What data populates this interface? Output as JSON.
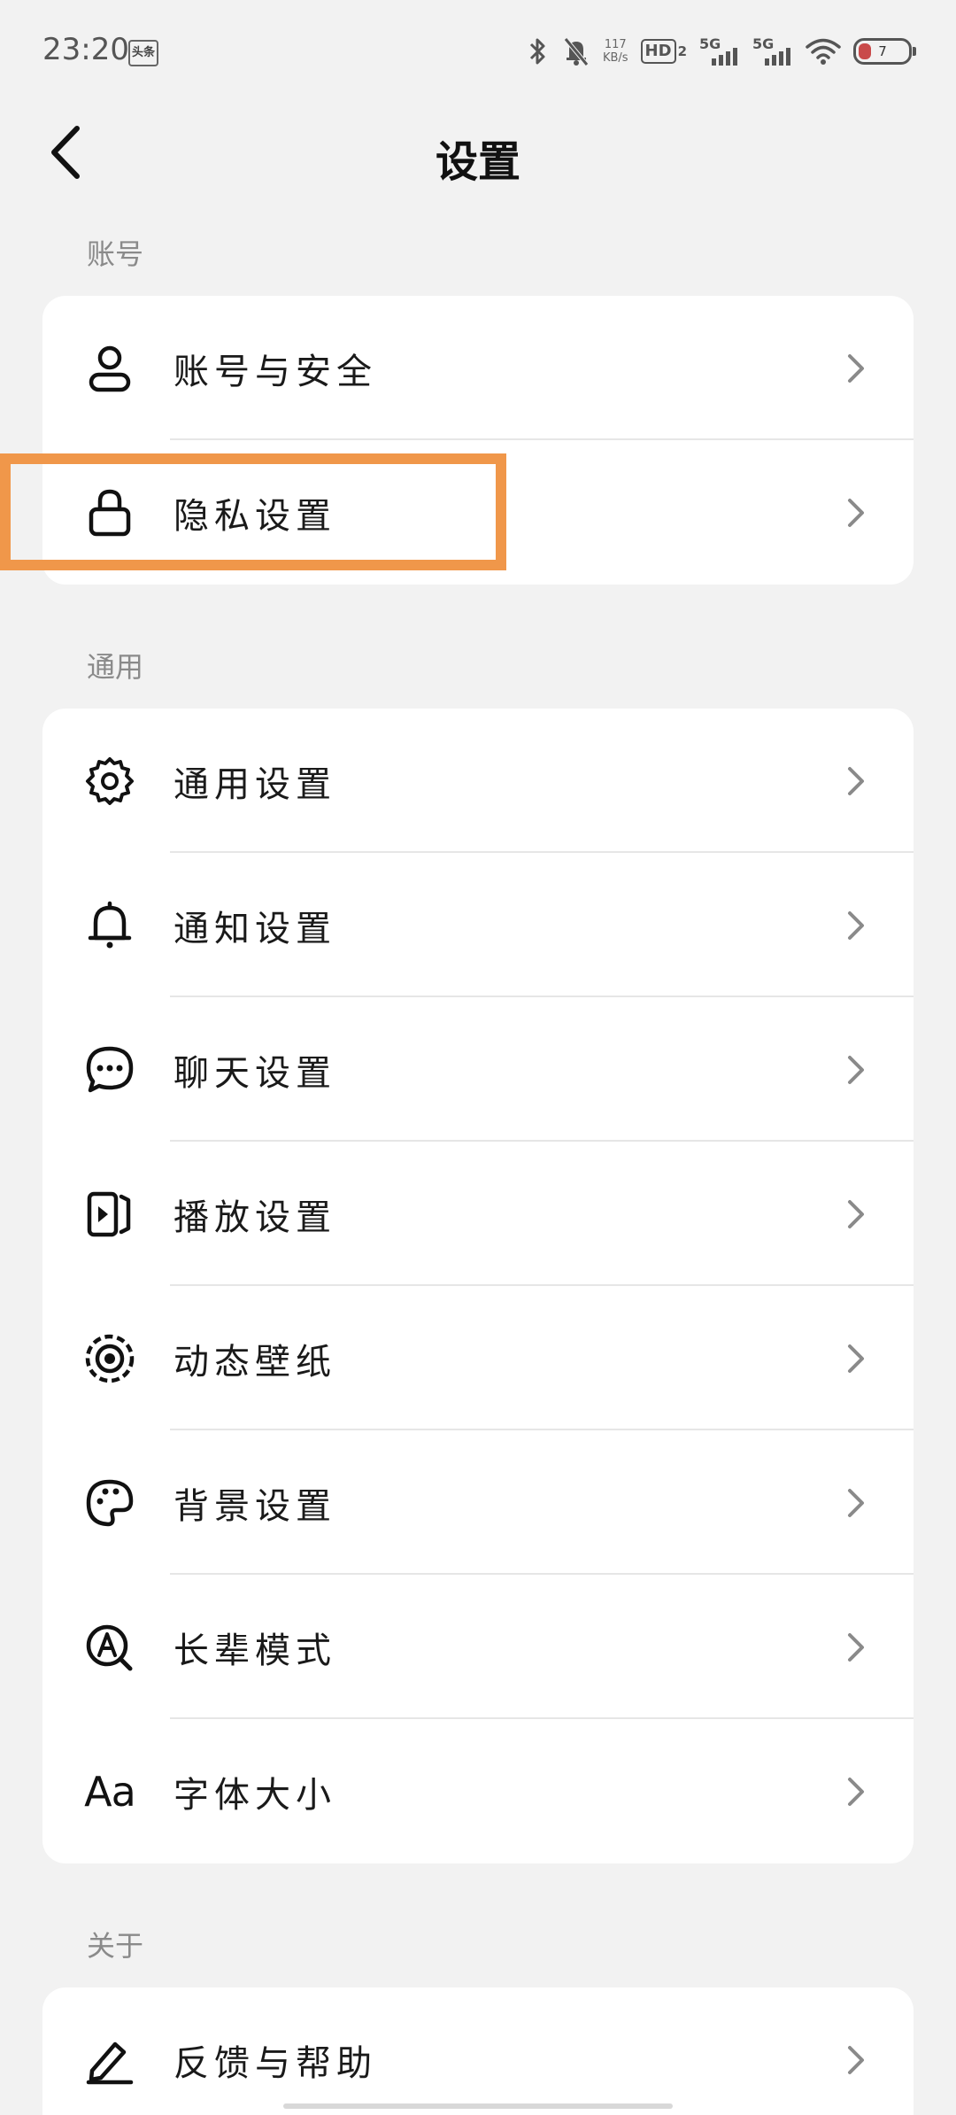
{
  "status_bar": {
    "time": "23:20",
    "app_badge": "头条",
    "net_speed_value": "117",
    "net_speed_unit": "KB/s",
    "hd_label": "HD",
    "hd_sub": "2",
    "sim1_label": "5G",
    "sim2_label": "5G",
    "battery_level": "7"
  },
  "header": {
    "title": "设置"
  },
  "sections": {
    "account": {
      "label": "账号",
      "items": [
        {
          "label": "账号与安全",
          "icon": "person-icon"
        },
        {
          "label": "隐私设置",
          "icon": "lock-icon"
        }
      ]
    },
    "general": {
      "label": "通用",
      "items": [
        {
          "label": "通用设置",
          "icon": "gear-icon"
        },
        {
          "label": "通知设置",
          "icon": "bell-icon"
        },
        {
          "label": "聊天设置",
          "icon": "chat-bubble-icon"
        },
        {
          "label": "播放设置",
          "icon": "play-icon"
        },
        {
          "label": "动态壁纸",
          "icon": "live-wallpaper-icon"
        },
        {
          "label": "背景设置",
          "icon": "palette-icon"
        },
        {
          "label": "长辈模式",
          "icon": "elder-mode-icon"
        },
        {
          "label": "字体大小",
          "icon": "font-size-icon",
          "icon_text": "Aa"
        }
      ]
    },
    "about": {
      "label": "关于",
      "items": [
        {
          "label": "反馈与帮助",
          "icon": "pencil-icon"
        }
      ]
    }
  },
  "colors": {
    "background": "#f2f2f2",
    "card": "#ffffff",
    "highlight": "#f0974a",
    "text": "#1a1a1a",
    "secondary_text": "#8a8a8a",
    "chevron": "#8a8a8a"
  }
}
